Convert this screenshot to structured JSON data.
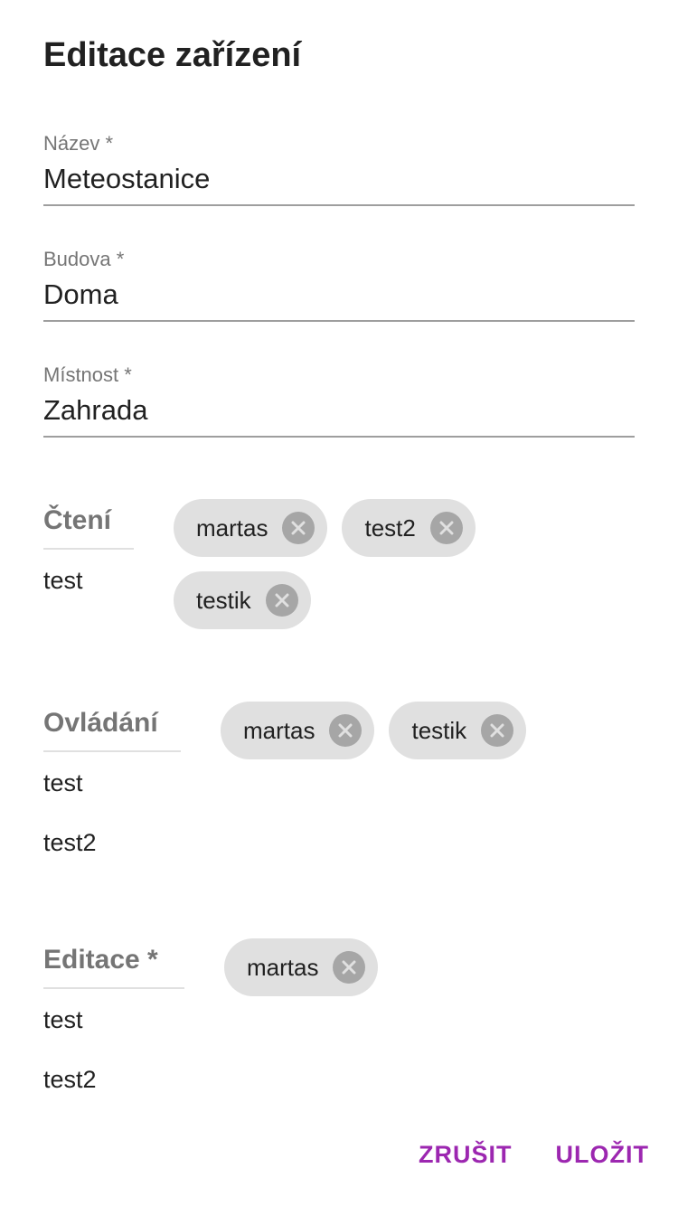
{
  "dialog": {
    "title": "Editace zařízení"
  },
  "fields": {
    "name": {
      "label": "Název *",
      "value": "Meteostanice"
    },
    "building": {
      "label": "Budova *",
      "value": "Doma"
    },
    "room": {
      "label": "Místnost *",
      "value": "Zahrada"
    }
  },
  "permissions": {
    "read": {
      "label": "Čtení",
      "options": [
        "test"
      ],
      "chips": [
        "martas",
        "test2",
        "testik"
      ]
    },
    "control": {
      "label": "Ovládání",
      "options": [
        "test",
        "test2"
      ],
      "chips": [
        "martas",
        "testik"
      ]
    },
    "edit": {
      "label": "Editace *",
      "options": [
        "test",
        "test2"
      ],
      "chips": [
        "martas"
      ]
    }
  },
  "actions": {
    "cancel_label": "ZRUŠIT",
    "save_label": "ULOŽIT"
  },
  "colors": {
    "accent": "#9c27b0",
    "chip_background": "#e0e0e0",
    "chip_remove": "#a6a6a6"
  },
  "icons": {
    "chip_remove": "close-circle-icon"
  }
}
